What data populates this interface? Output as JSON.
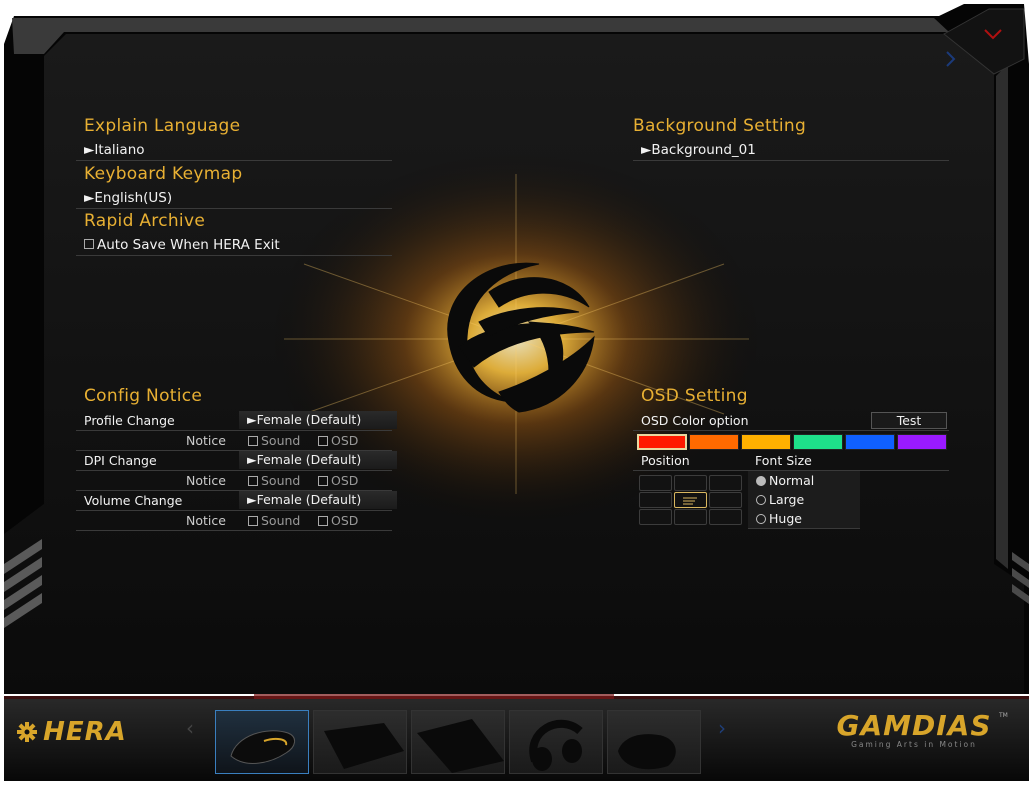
{
  "app": {
    "name": "HERA",
    "brand": "GAMDIAS",
    "tagline": "Gaming Arts in Motion",
    "trademark": "TM"
  },
  "window_controls": {
    "close_icon": "close-chevron-icon",
    "min_icon": "minimize-chevron-icon"
  },
  "explain_language": {
    "title": "Explain Language",
    "value": "►Italiano"
  },
  "keyboard_keymap": {
    "title": "Keyboard Keymap",
    "value": "►English(US)"
  },
  "rapid_archive": {
    "title": "Rapid Archive",
    "checkbox_label": "Auto Save When HERA Exit",
    "checked": false
  },
  "background_setting": {
    "title": "Background Setting",
    "value": "►Background_01"
  },
  "config_notice": {
    "title": "Config Notice",
    "notice_label": "Notice",
    "sound_label": "Sound",
    "osd_label": "OSD",
    "items": [
      {
        "label": "Profile Change",
        "value": "►Female (Default)"
      },
      {
        "label": "DPI Change",
        "value": "►Female (Default)"
      },
      {
        "label": "Volume Change",
        "value": "►Female (Default)"
      }
    ]
  },
  "osd_setting": {
    "title": "OSD Setting",
    "color_option_label": "OSD Color option",
    "test_label": "Test",
    "colors": [
      "#ff1a00",
      "#ff6a00",
      "#ffb000",
      "#1ee08a",
      "#1060ff",
      "#9a1aff"
    ],
    "selected_color": 0,
    "position_label": "Position",
    "font_size_label": "Font Size",
    "font_sizes": [
      {
        "label": "Normal",
        "selected": true
      },
      {
        "label": "Large",
        "selected": false
      },
      {
        "label": "Huge",
        "selected": false
      }
    ]
  },
  "nav": {
    "prev_icon": "left-arrow-icon",
    "next_icon": "right-arrow-icon",
    "devices": [
      "mouse",
      "mousepad",
      "keyboard",
      "headset",
      "speaker"
    ],
    "active_device": 0
  }
}
